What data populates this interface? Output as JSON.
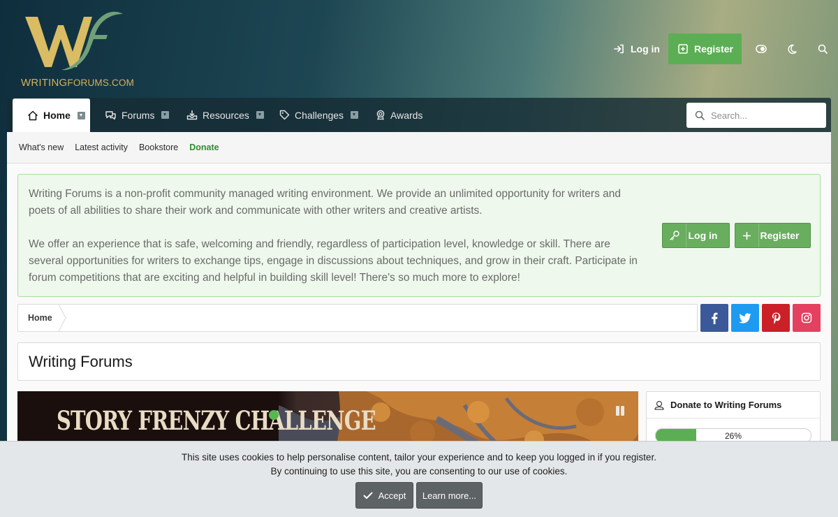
{
  "site": {
    "logo_text_prefix": "WRITING",
    "logo_text_suffix": "FORUMS.COM"
  },
  "header": {
    "login_label": "Log in",
    "register_label": "Register"
  },
  "nav": {
    "tabs": [
      {
        "label": "Home",
        "icon": "home-icon",
        "active": true
      },
      {
        "label": "Forums",
        "icon": "comments-icon"
      },
      {
        "label": "Resources",
        "icon": "download-tray-icon"
      },
      {
        "label": "Challenges",
        "icon": "tag-icon"
      },
      {
        "label": "Awards",
        "icon": "award-icon"
      }
    ],
    "search_placeholder": "Search..."
  },
  "subnav": {
    "items": [
      "What's new",
      "Latest activity",
      "Bookstore",
      "Donate"
    ]
  },
  "notice": {
    "paragraph1": "Writing Forums is a non-profit community managed writing environment. We provide an unlimited opportunity for writers and poets of all abilities to share their work and communicate with other writers and creative artists.",
    "paragraph2": "We offer an experience that is safe, welcoming and friendly, regardless of participation level, knowledge or skill. There are several opportunities for writers to exchange tips, engage in discussions about techniques, and grow in their craft. Participate in forum competitions that are exciting and helpful in building skill level! There's so much more to explore!",
    "login_label": "Log in",
    "register_label": "Register"
  },
  "breadcrumb": {
    "items": [
      "Home"
    ]
  },
  "social": [
    {
      "icon": "facebook-icon",
      "color": "#3b5998"
    },
    {
      "icon": "twitter-icon",
      "color": "#1d9bf0"
    },
    {
      "icon": "pinterest-icon",
      "color": "#cb2027"
    },
    {
      "icon": "instagram-icon",
      "color": "#e4405f"
    }
  ],
  "page": {
    "title": "Writing Forums"
  },
  "slider": {
    "banner_text": "STORY FRENZY CHALLENGE"
  },
  "donate_widget": {
    "title": "Donate to Writing Forums",
    "progress_percent": 26,
    "progress_label": "26%"
  },
  "cookie_notice": {
    "line1": "This site uses cookies to help personalise content, tailor your experience and to keep you logged in if you register.",
    "line2": "By continuing to use this site, you are consenting to our use of cookies.",
    "accept_label": "Accept",
    "learn_more_label": "Learn more..."
  },
  "colors": {
    "accent_green": "#5cae54",
    "donate_link": "#2e8f2e"
  }
}
